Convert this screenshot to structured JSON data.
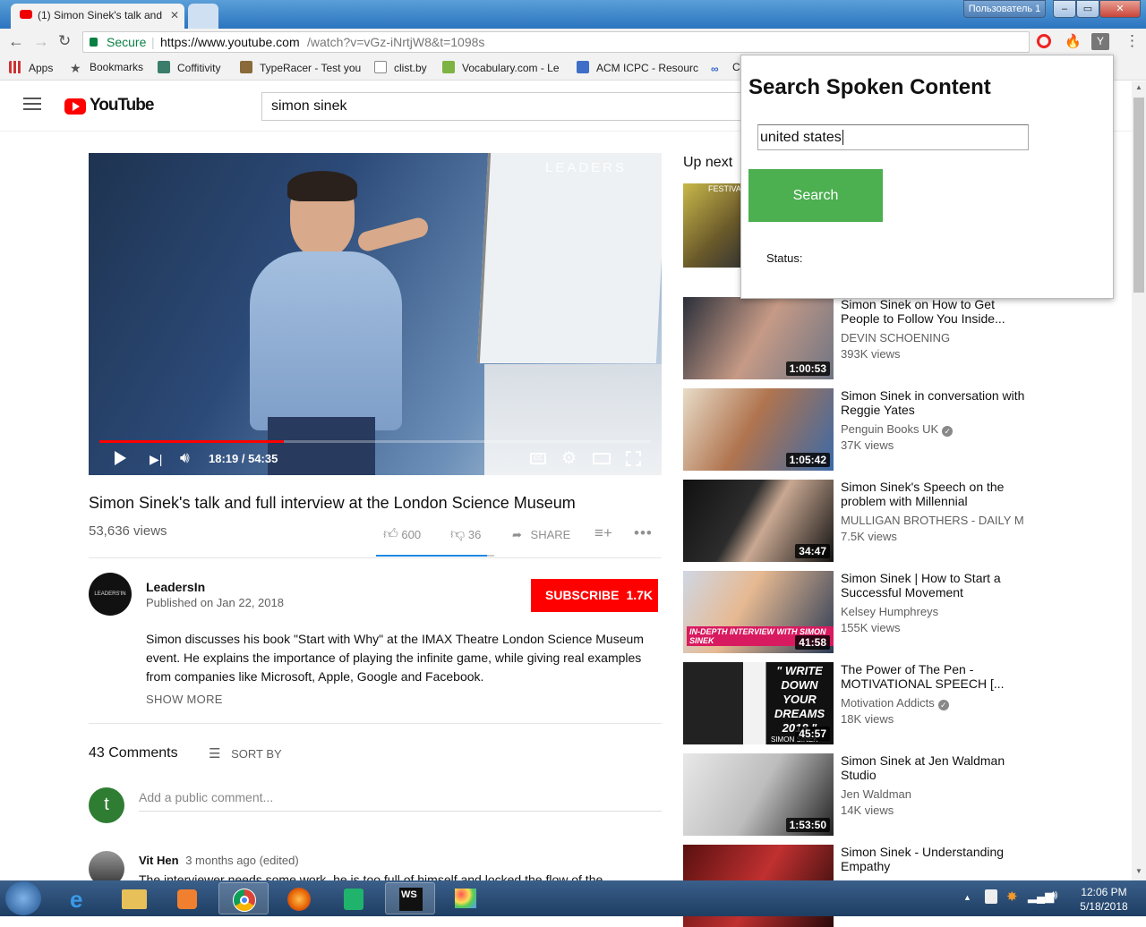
{
  "browser": {
    "tabs": [
      {
        "label": "(1) Simon Sinek's talk and"
      }
    ],
    "user_label": "Пользователь 1",
    "secure_label": "Secure",
    "url_host": "https://www.youtube.com",
    "url_path": "/watch?v=vGz-iNrtjW8&t=1098s",
    "bookmarks": [
      "Apps",
      "Bookmarks",
      "Coffitivity",
      "TypeRacer - Test you",
      "clist.by",
      "Vocabulary.com - Le",
      "ACM ICPC - Resourc",
      "C"
    ]
  },
  "youtube": {
    "logo_text": "YouTube",
    "search_value": "simon sinek",
    "video": {
      "overlay_brand": "LEADERS",
      "time_current": "18:19",
      "time_sep": " / ",
      "time_total": "54:35",
      "progress": 0.335,
      "title": "Simon Sinek's talk and full interview at the London Science Museum",
      "views": "53,636 views",
      "likes": "600",
      "dislikes": "36",
      "share": "SHARE",
      "like_ratio": 0.94
    },
    "channel": {
      "name": "LeadersIn",
      "avatar_text": "LEADERS'IN",
      "published": "Published on Jan 22, 2018",
      "subscribe_label": "SUBSCRIBE",
      "subscriber_count": "1.7K",
      "description": "Simon discusses his book \"Start with Why\" at the IMAX Theatre London Science Museum event. He explains the importance of playing the infinite game, while giving real examples from companies like Microsoft, Apple, Google and Facebook.",
      "show_more": "SHOW MORE"
    },
    "comments": {
      "count": "43 Comments",
      "sort_by": "SORT BY",
      "placeholder": "Add a public comment...",
      "user_avatar": "t",
      "first": {
        "author": "Vit Hen",
        "time": "3 months ago (edited)",
        "text": "The interviewer needs some work, he is too full of himself and locked the flow of the"
      }
    },
    "up_next_label": "Up next",
    "recommendations": [
      {
        "title": "Simon Sinek on How to Get People to Follow You Inside...",
        "channel": "DEVIN SCHOENING",
        "views": "393K views",
        "duration": "1:00:53",
        "verified": false
      },
      {
        "title": "Simon Sinek in conversation with Reggie Yates",
        "channel": "Penguin Books UK",
        "views": "37K views",
        "duration": "1:05:42",
        "verified": true
      },
      {
        "title": "Simon Sinek's Speech on the problem with Millennial",
        "channel": "MULLIGAN BROTHERS - DAILY MOT",
        "views": "7.5K views",
        "duration": "34:47",
        "verified": false
      },
      {
        "title": "Simon Sinek | How to Start a Successful Movement",
        "channel": "Kelsey Humphreys",
        "views": "155K views",
        "duration": "41:58",
        "verified": false,
        "thumb_caption": "IN-DEPTH INTERVIEW WITH SIMON SINEK"
      },
      {
        "title": "The Power of The Pen - MOTIVATIONAL SPEECH [...",
        "channel": "Motivation Addicts",
        "views": "18K views",
        "duration": "45:57",
        "verified": true,
        "thumb_caption": "\" WRITE DOWN YOUR DREAMS 2018 \"",
        "thumb_sub": "SIMON SINEK"
      },
      {
        "title": "Simon Sinek at Jen Waldman Studio",
        "channel": "Jen Waldman",
        "views": "14K views",
        "duration": "1:53:50",
        "verified": false
      },
      {
        "title": "Simon Sinek - Understanding Empathy",
        "channel": "",
        "views": "",
        "duration": "",
        "verified": false
      }
    ],
    "first_rec_badge": "FESTIVAL"
  },
  "popup": {
    "title": "Search Spoken Content",
    "input_value": "united states",
    "search_button": "Search",
    "status_label": "Status:"
  },
  "taskbar": {
    "time": "12:06 PM",
    "date": "5/18/2018"
  },
  "colors": {
    "youtube_red": "#ff0000",
    "subscribe_red": "#ff0000",
    "search_button_green": "#4caf50",
    "progress_red": "#ff0000"
  }
}
